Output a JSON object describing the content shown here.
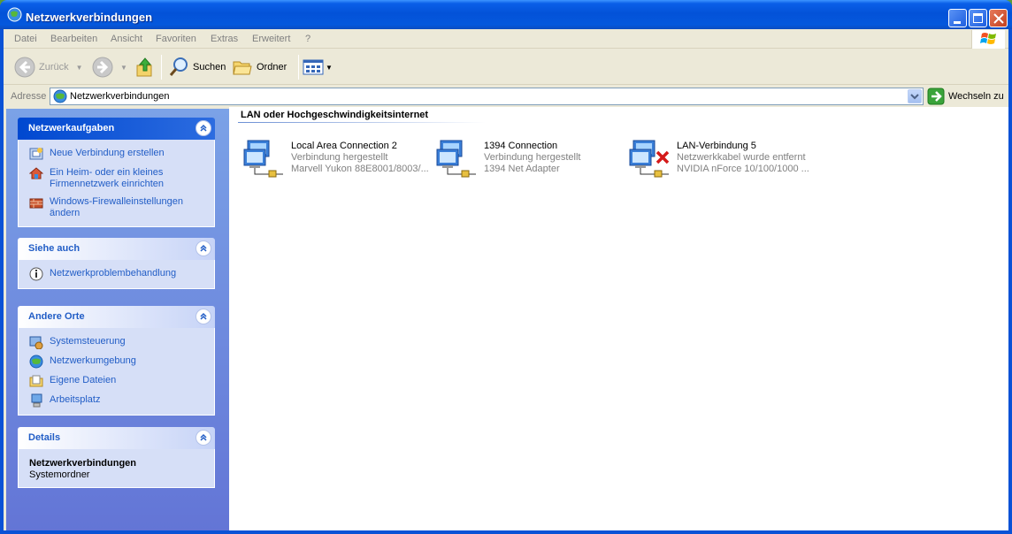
{
  "window": {
    "title": "Netzwerkverbindungen"
  },
  "menu": [
    "Datei",
    "Bearbeiten",
    "Ansicht",
    "Favoriten",
    "Extras",
    "Erweitert",
    "?"
  ],
  "toolbar": {
    "back": "Zurück",
    "search": "Suchen",
    "folders": "Ordner"
  },
  "address": {
    "label": "Adresse",
    "value": "Netzwerkverbindungen",
    "go": "Wechseln zu"
  },
  "panels": {
    "tasks": {
      "title": "Netzwerkaufgaben",
      "items": [
        "Neue Verbindung erstellen",
        "Ein Heim- oder ein kleines Firmennetzwerk einrichten",
        "Windows-Firewalleinstellungen ändern"
      ]
    },
    "see_also": {
      "title": "Siehe auch",
      "items": [
        "Netzwerkproblembehandlung"
      ]
    },
    "other": {
      "title": "Andere Orte",
      "items": [
        "Systemsteuerung",
        "Netzwerkumgebung",
        "Eigene Dateien",
        "Arbeitsplatz"
      ]
    },
    "details": {
      "title": "Details",
      "name": "Netzwerkverbindungen",
      "type": "Systemordner"
    }
  },
  "content": {
    "group": "LAN oder Hochgeschwindigkeitsinternet",
    "connections": [
      {
        "name": "Local Area Connection 2",
        "status": "Verbindung hergestellt",
        "device": "Marvell Yukon 88E8001/8003/..."
      },
      {
        "name": "1394 Connection",
        "status": "Verbindung hergestellt",
        "device": "1394 Net Adapter"
      },
      {
        "name": "LAN-Verbindung 5",
        "status": "Netzwerkkabel wurde entfernt",
        "device": "NVIDIA nForce 10/100/1000 ..."
      }
    ]
  },
  "colors": {
    "titlebar": "#0352d8",
    "link": "#215dc6",
    "sidebar": "#7ba2e7"
  }
}
